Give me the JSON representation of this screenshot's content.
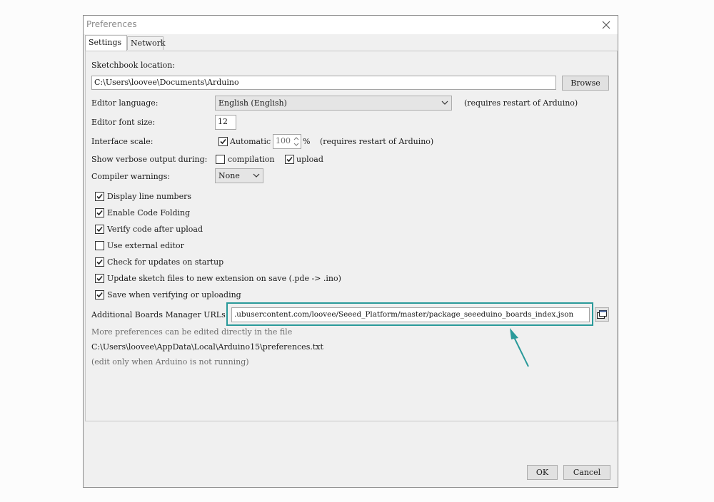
{
  "window": {
    "title": "Preferences"
  },
  "tabs": [
    {
      "label": "Settings",
      "active": true
    },
    {
      "label": "Network",
      "active": false
    }
  ],
  "sketchbook": {
    "label": "Sketchbook location:",
    "path": "C:\\Users\\loovee\\Documents\\Arduino",
    "browse_label": "Browse"
  },
  "editor_language": {
    "label": "Editor language:",
    "value": "English (English)",
    "note": "(requires restart of Arduino)"
  },
  "editor_font_size": {
    "label": "Editor font size:",
    "value": "12"
  },
  "interface_scale": {
    "label": "Interface scale:",
    "auto_label": "Automatic",
    "auto_checked": true,
    "value": "100",
    "unit": "%",
    "note": "(requires restart of Arduino)"
  },
  "verbose": {
    "label": "Show verbose output during:",
    "compilation_label": "compilation",
    "compilation_checked": false,
    "upload_label": "upload",
    "upload_checked": true
  },
  "compiler_warnings": {
    "label": "Compiler warnings:",
    "value": "None"
  },
  "options": [
    {
      "label": "Display line numbers",
      "checked": true
    },
    {
      "label": "Enable Code Folding",
      "checked": true
    },
    {
      "label": "Verify code after upload",
      "checked": true
    },
    {
      "label": "Use external editor",
      "checked": false
    },
    {
      "label": "Check for updates on startup",
      "checked": true
    },
    {
      "label": "Update sketch files to new extension on save (.pde -> .ino)",
      "checked": true
    },
    {
      "label": "Save when verifying or uploading",
      "checked": true
    }
  ],
  "boards_manager": {
    "label": "Additional Boards Manager URLs:",
    "value": ".ubusercontent.com/loovee/Seeed_Platform/master/package_seeeduino_boards_index.json"
  },
  "footer_info": {
    "line1": "More preferences can be edited directly in the file",
    "line2": "C:\\Users\\loovee\\AppData\\Local\\Arduino15\\preferences.txt",
    "line3": "(edit only when Arduino is not running)"
  },
  "buttons": {
    "ok": "OK",
    "cancel": "Cancel"
  },
  "colors": {
    "highlight": "#2a9a9a",
    "arrow": "#2a9a9a"
  }
}
